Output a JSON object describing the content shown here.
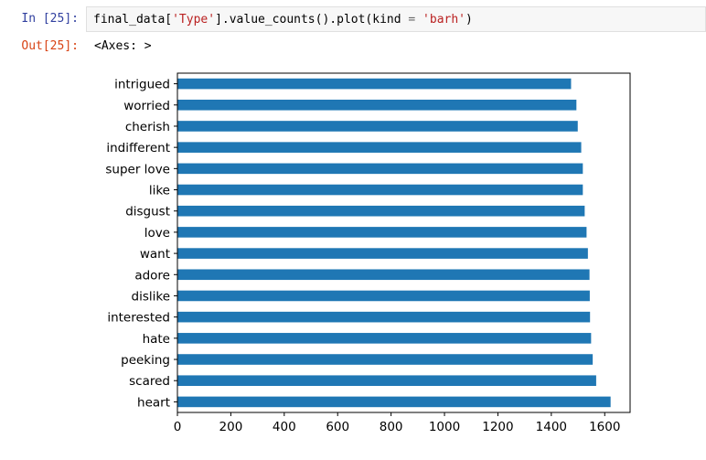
{
  "input_cell": {
    "prompt": "In [25]:",
    "code_prefix": "final_data[",
    "code_string1": "'Type'",
    "code_middle": "].value_counts().plot(kind ",
    "code_equals": "=",
    "code_space": " ",
    "code_string2": "'barh'",
    "code_suffix": ")"
  },
  "output_cell": {
    "prompt": "Out[25]:",
    "text": "<Axes: >"
  },
  "chart_data": {
    "type": "bar",
    "orientation": "horizontal",
    "categories": [
      "heart",
      "scared",
      "peeking",
      "hate",
      "interested",
      "dislike",
      "adore",
      "want",
      "love",
      "disgust",
      "like",
      "super love",
      "indifferent",
      "cherish",
      "worried",
      "intrigued"
    ],
    "values": [
      1622,
      1568,
      1555,
      1549,
      1545,
      1544,
      1543,
      1537,
      1532,
      1525,
      1518,
      1518,
      1512,
      1499,
      1494,
      1474
    ],
    "xticks": [
      "0",
      "200",
      "400",
      "600",
      "800",
      "1000",
      "1200",
      "1400",
      "1600"
    ],
    "xlim": [
      0,
      1695
    ],
    "bar_color": "#1f77b4",
    "grid": false,
    "title": "",
    "xlabel": "",
    "ylabel": ""
  }
}
